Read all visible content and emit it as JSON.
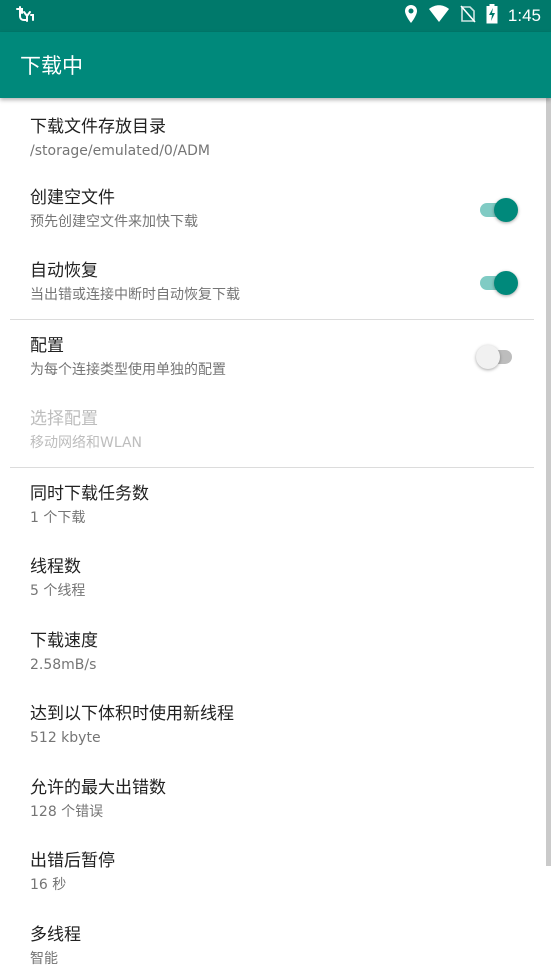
{
  "status_bar": {
    "time": "1:45",
    "icons": [
      "usb-debug-icon",
      "location-icon",
      "wifi-icon",
      "no-sim-icon",
      "battery-charging-icon"
    ]
  },
  "app_bar": {
    "title": "下载中"
  },
  "colors": {
    "primary": "#00897b",
    "primary_dark": "#00796b",
    "switch_track_on": "#80cbc4"
  },
  "prefs": [
    {
      "title": "下载文件存放目录",
      "summary": "/storage/emulated/0/ADM"
    },
    {
      "title": "创建空文件",
      "summary": "预先创建空文件来加快下载",
      "switch": "on"
    },
    {
      "title": "自动恢复",
      "summary": "当出错或连接中断时自动恢复下载",
      "switch": "on"
    },
    {
      "title": "配置",
      "summary": "为每个连接类型使用单独的配置",
      "switch": "off"
    },
    {
      "title": "选择配置",
      "summary": "移动网络和WLAN",
      "disabled": true
    },
    {
      "title": "同时下载任务数",
      "summary": "1 个下载"
    },
    {
      "title": "线程数",
      "summary": "5 个线程"
    },
    {
      "title": "下载速度",
      "summary": "2.58mB/s"
    },
    {
      "title": "达到以下体积时使用新线程",
      "summary": "512 kbyte"
    },
    {
      "title": "允许的最大出错数",
      "summary": "128 个错误"
    },
    {
      "title": "出错后暂停",
      "summary": "16 秒"
    },
    {
      "title": "多线程",
      "summary": "智能"
    }
  ]
}
